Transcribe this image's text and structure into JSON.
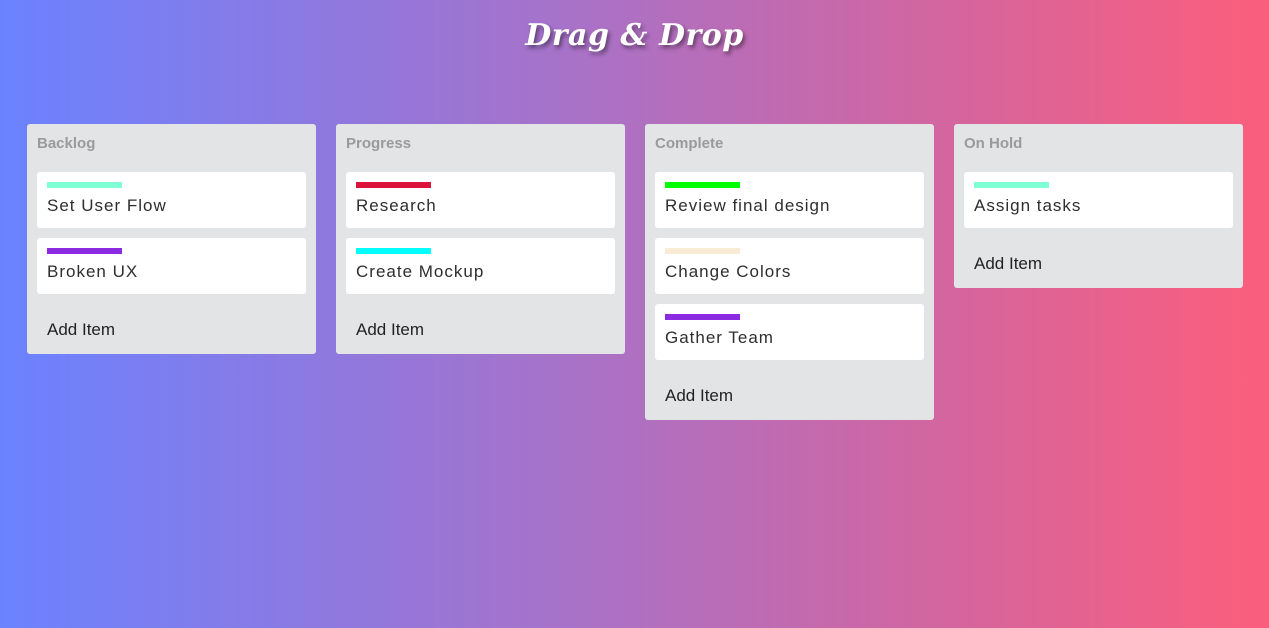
{
  "title": "Drag & Drop",
  "columns": [
    {
      "name": "Backlog",
      "add_label": "Add Item",
      "cards": [
        {
          "text": "Set User Flow",
          "color": "#7fffd4"
        },
        {
          "text": "Broken UX",
          "color": "#8a2be2"
        }
      ]
    },
    {
      "name": "Progress",
      "add_label": "Add Item",
      "cards": [
        {
          "text": "Research",
          "color": "#dc143c"
        },
        {
          "text": "Create Mockup",
          "color": "#00ffff"
        }
      ]
    },
    {
      "name": "Complete",
      "add_label": "Add Item",
      "cards": [
        {
          "text": "Review final design",
          "color": "#00ff00"
        },
        {
          "text": "Change Colors",
          "color": "#faebd7"
        },
        {
          "text": "Gather Team",
          "color": "#8a2be2"
        }
      ]
    },
    {
      "name": "On Hold",
      "add_label": "Add Item",
      "cards": [
        {
          "text": "Assign tasks",
          "color": "#7fffd4"
        }
      ]
    }
  ]
}
